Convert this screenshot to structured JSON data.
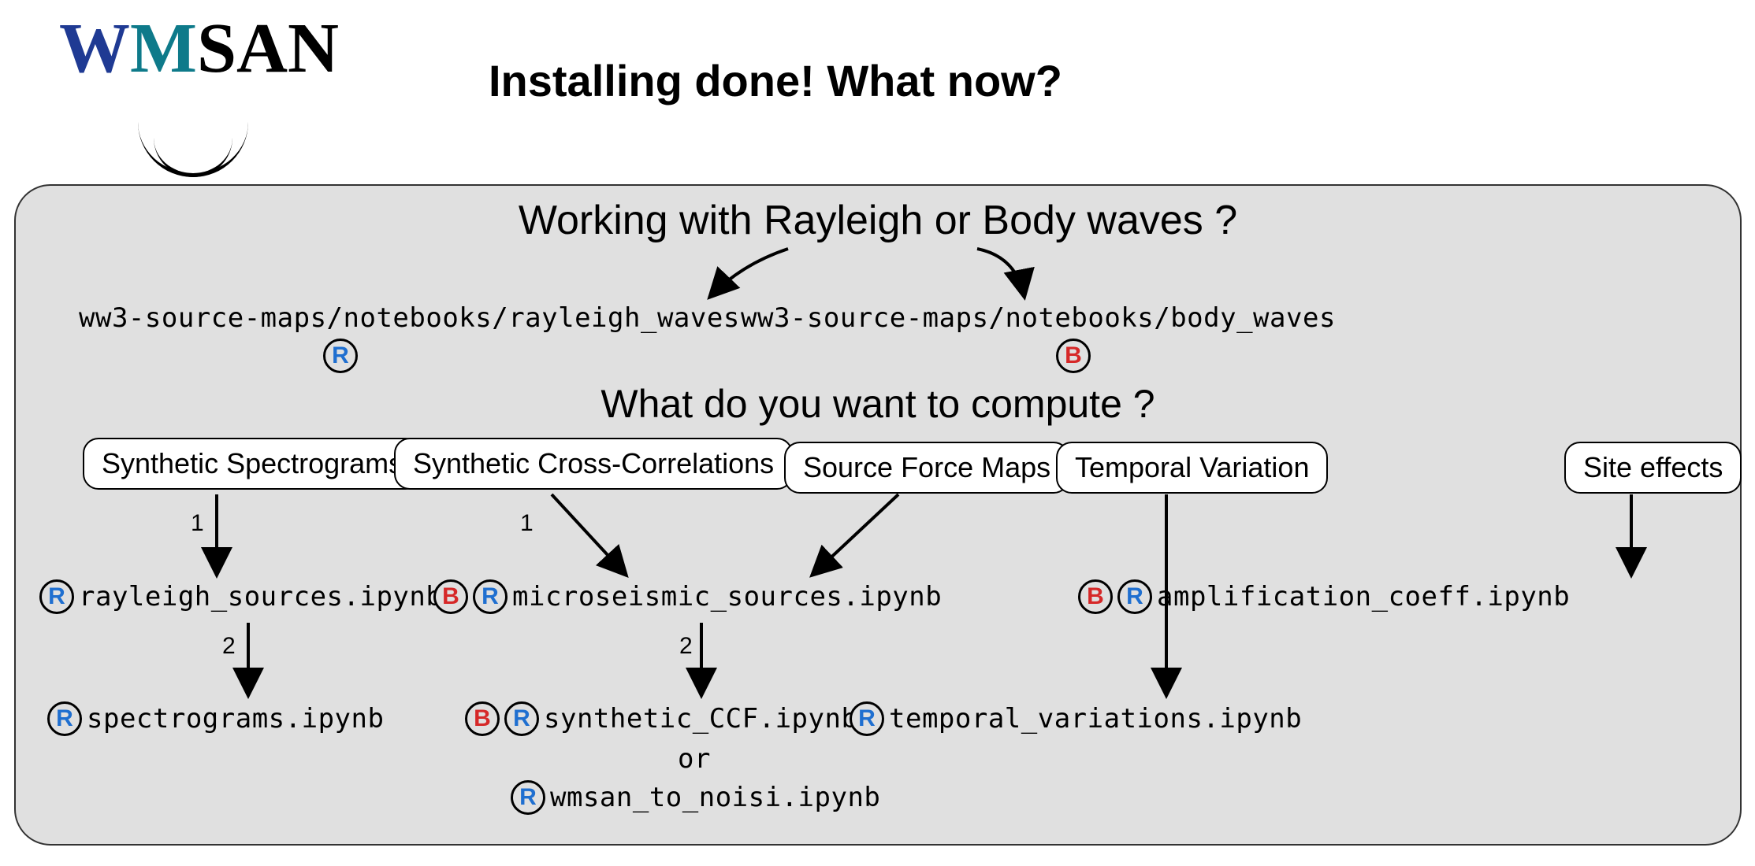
{
  "logo_text": {
    "w": "W",
    "m": "M",
    "san": "SAN"
  },
  "title": "Installing done! What now?",
  "question1": "Working with Rayleigh or Body waves ?",
  "question2": "What do you want to compute ?",
  "paths": {
    "rayleigh": "ww3-source-maps/notebooks/rayleigh_waves",
    "body": "ww3-source-maps/notebooks/body_waves"
  },
  "badges": {
    "r": "R",
    "b": "B"
  },
  "choices": {
    "spectrograms": "Synthetic Spectrograms",
    "cross_corr": "Synthetic Cross-Correlations",
    "source_force": "Source Force Maps",
    "temporal": "Temporal  Variation",
    "site_effects": "Site effects"
  },
  "notebooks": {
    "rayleigh_sources": "rayleigh_sources.ipynb",
    "spectrograms": "spectrograms.ipynb",
    "microseismic_sources": "microseismic_sources.ipynb",
    "synthetic_ccf": "synthetic_CCF.ipynb",
    "or": "or",
    "wmsan_to_noisi": "wmsan_to_noisi.ipynb",
    "temporal_variations": "temporal_variations.ipynb",
    "amplification_coeff": "amplification_coeff.ipynb"
  },
  "step_labels": {
    "one": "1",
    "two": "2"
  }
}
